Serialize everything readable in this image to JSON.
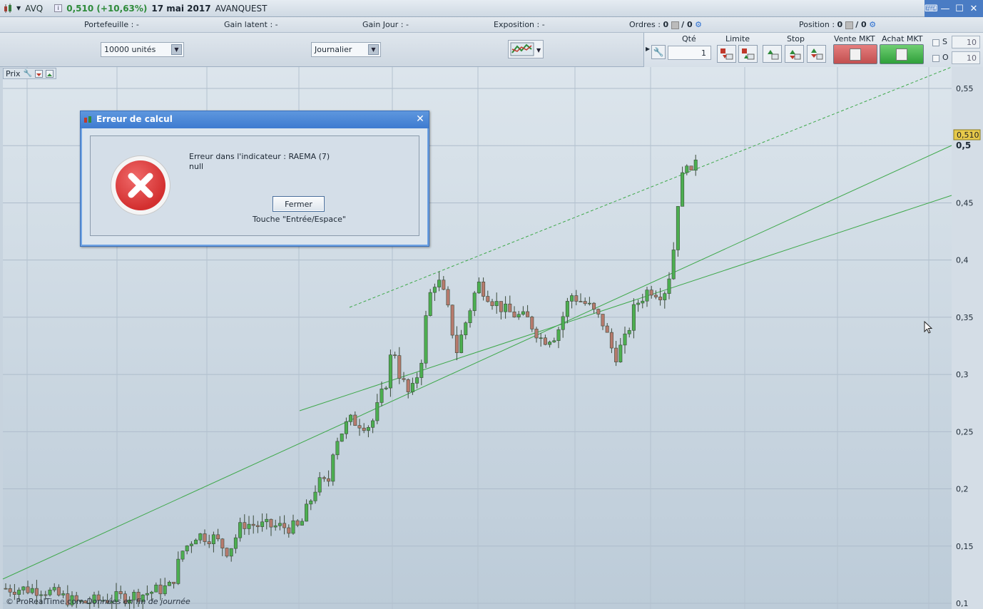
{
  "titlebar": {
    "symbol": "AVQ",
    "price": "0,510 (+10,63%)",
    "date": "17 mai 2017",
    "name": "AVANQUEST"
  },
  "summary": {
    "portefeuille": "Portefeuille : -",
    "gain_latent": "Gain latent : -",
    "gain_jour": "Gain Jour : -",
    "exposition": "Exposition : -",
    "ordres_label": "Ordres :",
    "ordres_a": "0",
    "ordres_b": "/ 0",
    "position_label": "Position :",
    "position_a": "0",
    "position_b": "/ 0"
  },
  "toolbar": {
    "units": "10000 unités",
    "period": "Journalier",
    "qty_label": "Qté",
    "qty_value": "1",
    "limite_label": "Limite",
    "stop_label": "Stop",
    "vente_label": "Vente MKT",
    "achat_label": "Achat MKT",
    "s_label": "S",
    "o_label": "O",
    "s_value": "10",
    "o_value": "10"
  },
  "chart": {
    "tab_label": "Prix",
    "copyright": "© ProRealTime.com",
    "data_note": "Données en fin de journée",
    "price_tag": "0,510",
    "colors": {
      "up": "#4caf50",
      "down": "#b77a6d",
      "line": "#3ea84a"
    }
  },
  "chart_data": {
    "type": "candlestick",
    "y_ticks": [
      "0,55",
      "0,5",
      "0,45",
      "0,4",
      "0,35",
      "0,3",
      "0,25",
      "0,2",
      "0,15",
      "0,1"
    ],
    "ylim": [
      0.1,
      0.55
    ],
    "last_value": 0.51
  },
  "dialog": {
    "title": "Erreur de calcul",
    "message_line1": "Erreur dans l'indicateur : RAEMA (7)",
    "message_line2": "null",
    "button": "Fermer",
    "hint": "Touche \"Entrée/Espace\""
  }
}
